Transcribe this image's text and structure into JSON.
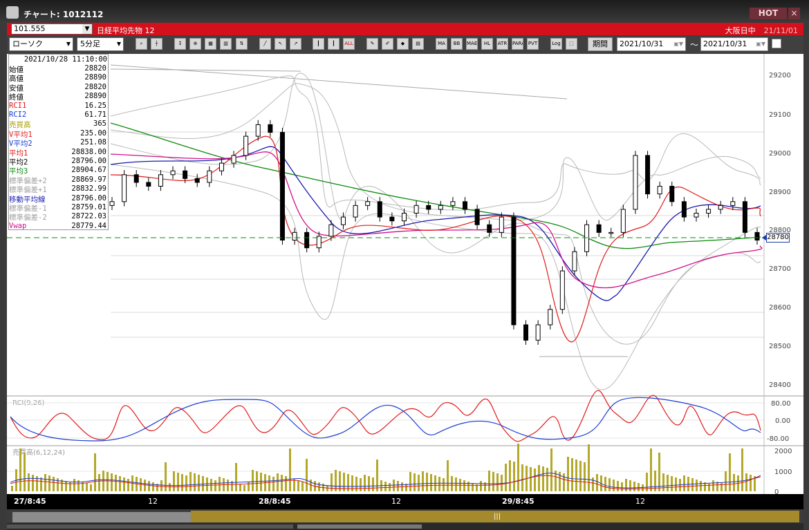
{
  "window": {
    "title": "チャート: 1012112",
    "hot_label": "HOT",
    "close_label": "×"
  },
  "symbol_bar": {
    "code_value": "101.555",
    "symbol_name": "日経平均先物 12",
    "session": "大阪日中",
    "date": "21/11/01"
  },
  "toolbar": {
    "chart_type": "ローソク",
    "timeframe": "5分足",
    "buttons": [
      "search-icon",
      "crosshair-icon",
      "tool-icon",
      "zoom-icon",
      "grid-icon",
      "bars-icon",
      "compare-icon",
      "line-icon",
      "cursor-icon",
      "arrow-icon",
      "candle-icon",
      "candle2-icon",
      "all-icon",
      "draw-icon",
      "pencil-icon",
      "color-icon",
      "indicator-icon",
      "MA",
      "BB",
      "MAE",
      "HL",
      "ATR",
      "PARA",
      "PVT",
      "Log",
      "export-icon"
    ],
    "all_label": "ALL",
    "ma_label": "MA",
    "bb_label": "BB",
    "mae_label": "MAE",
    "hl_label": "HL",
    "atr_label": "ATR",
    "para_label": "PARA",
    "pvt_label": "PVT",
    "log_label": "Log",
    "period_label": "期間",
    "date_from": "2021/10/31",
    "date_to": "2021/10/31",
    "tilde": "～"
  },
  "info_panel": {
    "timestamp": "2021/10/28 11:10:00",
    "rows": [
      {
        "label": "始値",
        "value": "28820",
        "color": "#000000"
      },
      {
        "label": "高値",
        "value": "28890",
        "color": "#000000"
      },
      {
        "label": "安値",
        "value": "28820",
        "color": "#000000"
      },
      {
        "label": "終値",
        "value": "28890",
        "color": "#000000"
      },
      {
        "label": "RCI1",
        "value": "16.25",
        "color": "#e01818"
      },
      {
        "label": "RCI2",
        "value": "61.71",
        "color": "#1a3ad0"
      },
      {
        "label": "売買高",
        "value": "365",
        "color": "#a8a000"
      },
      {
        "label": "V平均1",
        "value": "235.00",
        "color": "#e01818"
      },
      {
        "label": "V平均2",
        "value": "251.08",
        "color": "#1a3ad0"
      },
      {
        "label": "平均1",
        "value": "28838.00",
        "color": "#e01818"
      },
      {
        "label": "平均2",
        "value": "28796.00",
        "color": "#000000"
      },
      {
        "label": "平均3",
        "value": "28904.67",
        "color": "#0a8a0a"
      },
      {
        "label": "標準偏差+2",
        "value": "28869.97",
        "color": "#a0a0a0"
      },
      {
        "label": "標準偏差+1",
        "value": "28832.99",
        "color": "#a0a0a0"
      },
      {
        "label": "移動平均線",
        "value": "28796.00",
        "color": "#1a1ab0"
      },
      {
        "label": "標準偏差-1",
        "value": "28759.01",
        "color": "#a0a0a0"
      },
      {
        "label": "標準偏差-2",
        "value": "28722.03",
        "color": "#a0a0a0"
      },
      {
        "label": "Vwap",
        "value": "28779.44",
        "color": "#d0108a"
      }
    ]
  },
  "price_axis": {
    "ticks": [
      "29200",
      "29100",
      "29000",
      "28900",
      "28800",
      "28700",
      "28600",
      "28500",
      "28400"
    ],
    "current_price": "28780"
  },
  "rci_panel": {
    "label": "RCI(9,26)",
    "ticks": [
      "80.00",
      "0.00",
      "-80.00"
    ]
  },
  "volume_panel": {
    "label": "売買高(6,12,24)",
    "ticks": [
      "2000",
      "1000",
      "0"
    ]
  },
  "time_axis": {
    "labels": [
      "27/8:45",
      "12",
      "28/8:45",
      "12",
      "29/8:45",
      "12"
    ]
  },
  "chart_data": {
    "type": "candlestick",
    "symbol": "日経平均先物 12",
    "interval": "5分足",
    "y_range": [
      28400,
      29250
    ],
    "series_colors": {
      "avg1": "#e01818",
      "avg2": "#1a1ab0",
      "avg3": "#0a8a0a",
      "vwap": "#d0108a",
      "bands": "#a0a0a0"
    },
    "close_points": [
      28880,
      28950,
      28930,
      28920,
      28950,
      28960,
      28940,
      28930,
      28960,
      28980,
      29000,
      29050,
      29080,
      29060,
      28780,
      28800,
      28760,
      28790,
      28820,
      28840,
      28870,
      28880,
      28840,
      28830,
      28850,
      28870,
      28860,
      28870,
      28880,
      28860,
      28820,
      28800,
      28840,
      28560,
      28520,
      28560,
      28600,
      28700,
      28750,
      28820,
      28800,
      28800,
      28860,
      29000,
      28900,
      28920,
      28880,
      28840,
      28850,
      28860,
      28870,
      28880,
      28800,
      28780
    ],
    "current_price": 28780
  }
}
